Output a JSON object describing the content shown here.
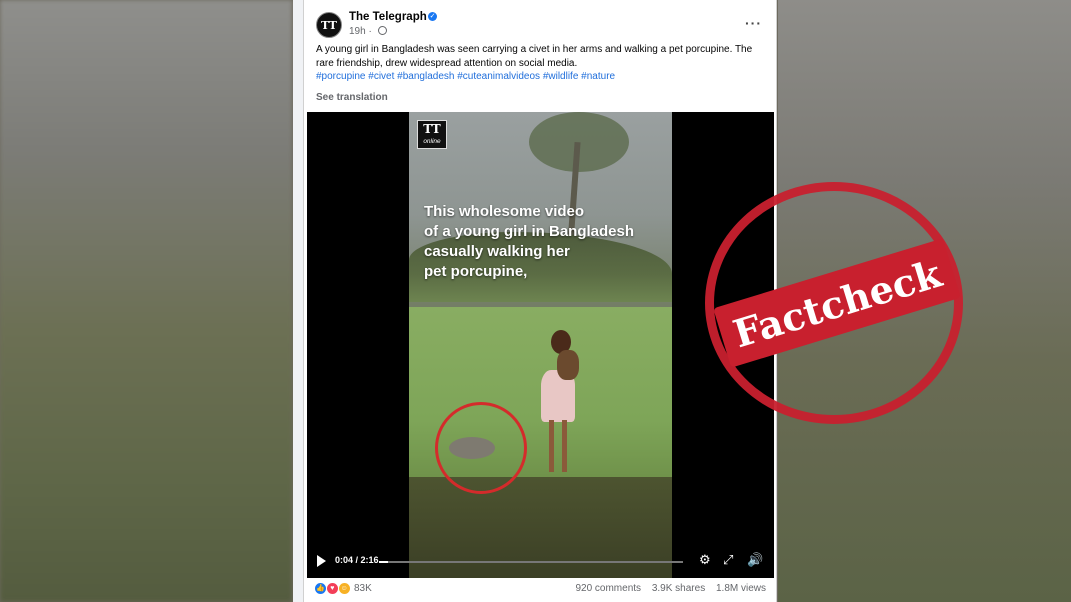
{
  "post": {
    "page_name": "The Telegraph",
    "avatar_text": "TT",
    "time": "19h",
    "text": "A young girl in Bangladesh was seen carrying a civet in her arms and walking a pet porcupine. The rare friendship, drew widespread attention on social media.",
    "hashtags": "#porcupine #civet #bangladesh #cuteanimalvideos #wildlife #nature",
    "see_translation": "See translation",
    "more_icon": "more-options-icon"
  },
  "video": {
    "logo_main": "TT",
    "logo_sub": "online",
    "caption_lines": [
      "This wholesome video",
      "of a young girl in Bangladesh",
      "casually walking her",
      "pet porcupine,"
    ],
    "timecode": "0:04 / 2:16",
    "progress": 0.03
  },
  "footer": {
    "reaction_count": "83K",
    "comments": "920 comments",
    "shares": "3.9K shares",
    "views": "1.8M views"
  },
  "stamp": {
    "text": "Factcheck",
    "color": "#c8202e"
  }
}
